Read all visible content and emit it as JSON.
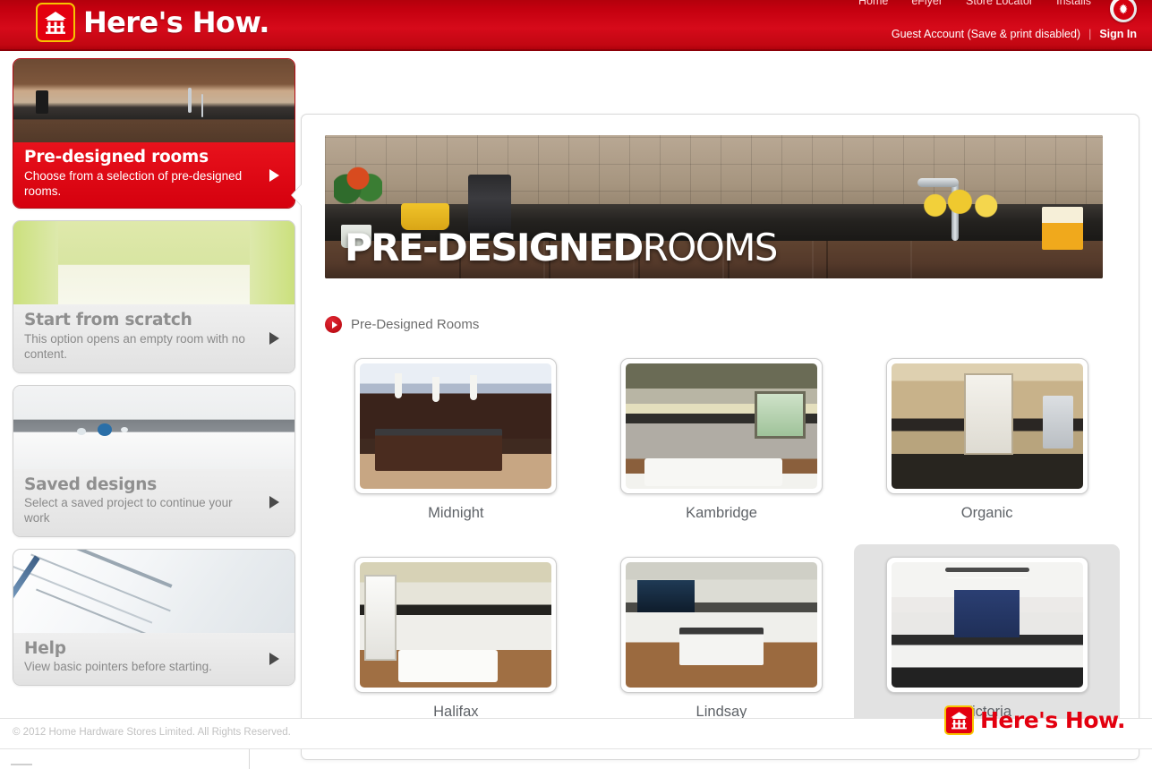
{
  "header": {
    "logo_text": "Here's How.",
    "logo_mark_name": "home-hardware-logo",
    "topnav": [
      {
        "label": "Home"
      },
      {
        "label": "eFlyer"
      },
      {
        "label": "Store Locator"
      },
      {
        "label": "Installs"
      }
    ],
    "leaf_badge_name": "canada-maple-leaf-badge",
    "account": {
      "guest_text": "Guest Account (Save & print disabled)",
      "divider": "|",
      "signin_label": "Sign In"
    },
    "brand_red": "#d40a18"
  },
  "sidebar": {
    "items": [
      {
        "title": "Pre-designed rooms",
        "desc": "Choose from a selection of pre-designed rooms.",
        "active": true,
        "thumb": "kitchen-dark-counter"
      },
      {
        "title": "Start from scratch",
        "desc": "This option opens an empty room with no content.",
        "active": false,
        "thumb": "empty-green-room"
      },
      {
        "title": "Saved designs",
        "desc": "Select a saved project to continue your work",
        "active": false,
        "thumb": "white-kitchen"
      },
      {
        "title": "Help",
        "desc": "View basic pointers before starting.",
        "active": false,
        "thumb": "blueprint-pencil"
      }
    ]
  },
  "content": {
    "banner": {
      "title_bold": "PRE-DESIGNED",
      "title_light": "ROOMS",
      "alt": "kitchen-counter-banner"
    },
    "breadcrumb": {
      "label": "Pre-Designed Rooms"
    },
    "rooms": [
      {
        "label": "Midnight",
        "art": "r-midnight",
        "selected": false
      },
      {
        "label": "Kambridge",
        "art": "r-kambridge",
        "selected": false
      },
      {
        "label": "Organic",
        "art": "r-organic",
        "selected": false
      },
      {
        "label": "Halifax",
        "art": "r-halifax",
        "selected": false
      },
      {
        "label": "Lindsay",
        "art": "r-lindsay",
        "selected": false
      },
      {
        "label": "Victoria",
        "art": "r-victoria",
        "selected": true
      }
    ]
  },
  "footer": {
    "copyright": "© 2012 Home Hardware Stores Limited. All Rights Reserved.",
    "logo_text": "Here's How."
  }
}
